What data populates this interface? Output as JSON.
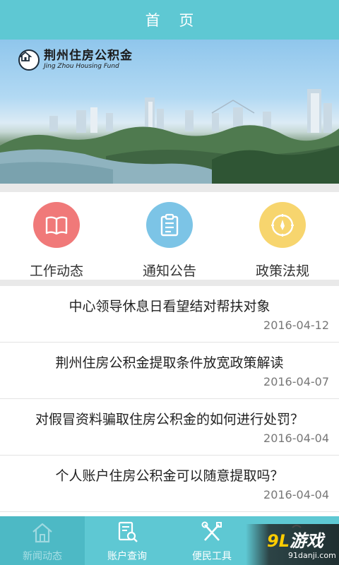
{
  "header": {
    "title": "首 页"
  },
  "banner": {
    "logo_cn": "荆州住房公积金",
    "logo_en": "Jing Zhou Housing Fund"
  },
  "quick_links": [
    {
      "label": "工作动态",
      "icon": "book-icon",
      "color": "#f07979"
    },
    {
      "label": "通知公告",
      "icon": "clipboard-icon",
      "color": "#7cc4e6"
    },
    {
      "label": "政策法规",
      "icon": "compass-icon",
      "color": "#f7d56e"
    }
  ],
  "news": [
    {
      "title": "中心领导休息日看望结对帮扶对象",
      "date": "2016-04-12"
    },
    {
      "title": "荆州住房公积金提取条件放宽政策解读",
      "date": "2016-04-07"
    },
    {
      "title": "对假冒资料骗取住房公积金的如何进行处罚？",
      "date": "2016-04-04"
    },
    {
      "title": "个人账户住房公积金可以随意提取吗？",
      "date": "2016-04-04"
    }
  ],
  "tabs": [
    {
      "label": "新闻动态",
      "icon": "home-icon",
      "active": true
    },
    {
      "label": "账户查询",
      "icon": "search-doc-icon",
      "active": false
    },
    {
      "label": "便民工具",
      "icon": "tools-icon",
      "active": false
    },
    {
      "label": "",
      "icon": "more-icon",
      "active": false
    }
  ],
  "watermark": {
    "logo_num": "9L",
    "logo_text": "游戏",
    "url": "91danji.com"
  },
  "colors": {
    "primary": "#5ec8d3",
    "divider": "#e9e9e9"
  }
}
